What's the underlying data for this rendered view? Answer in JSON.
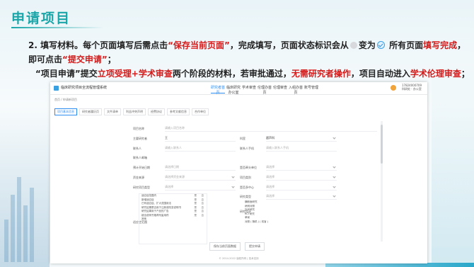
{
  "slide": {
    "title": "申请项目",
    "line1": {
      "p1": "2. 填写材料。每个页面填写后需点击",
      "r1": "“保存当前页面”",
      "p2": "，完成填写，页面状态标识会从",
      "p3": "变为",
      "p4": "所有页面",
      "r2": "填写完成",
      "p5": "，"
    },
    "line2": {
      "p1": "即可点击",
      "r1": "“提交申请”",
      "p2": "；"
    },
    "line3": {
      "p1": "“项目申请”提交",
      "r1": "立项受理+学术审查",
      "p2": "两个阶段的材料，若审批通过，",
      "r2": "无需研究者操作",
      "p3": "，项目自动进入",
      "r3": "学术伦理审查",
      "p4": "；"
    }
  },
  "app": {
    "name": "临床研究项目全流程管理系统",
    "nav": [
      "研究者首页",
      "临床研究办公室",
      "学术审查",
      "伦理办首页",
      "伦理审查",
      "入组办首页",
      "账号管理"
    ],
    "user_line1": "17824000709",
    "user_line2": "科研处 · 办公室",
    "breadcrumb": "首页 / 申请新项目",
    "steps": [
      "项目基本信息",
      "研究者履历页",
      "文件清单",
      "利益冲突声明",
      "经费协议",
      "参考文献信息",
      "合作单位"
    ],
    "form": {
      "project_name_label": "项目名称",
      "project_name_placeholder": "请输入项目名称",
      "funding_label": "主要研究者",
      "funding_value": "王",
      "dept_label": "科室",
      "dept_value": "超声科",
      "contact_label": "联系人",
      "contact_placeholder": "请输入联系人",
      "contact_phone_label": "联系人手机",
      "contact_phone_placeholder": "请输入联系人手机",
      "email_label": "联系人邮箱",
      "email_placeholder": "请输入联系人邮箱",
      "plan_date_label": "预计开始日期",
      "plan_date_placeholder": "请选择日期",
      "lead_unit_label": "是否牵头单位",
      "lead_unit_placeholder": "请选择",
      "fund_source_label": "资金来源",
      "fund_source_placeholder": "请选择资金来源",
      "project_type_label": "项目类别",
      "project_type_placeholder": "请选择",
      "research_type_label": "研究项目类型",
      "research_type_placeholder": "请选择",
      "multi_center_label": "是否多中心",
      "multi_center_placeholder": "请选择",
      "scope_label": "适应症范围",
      "design_label": "研究设计",
      "research_category_label": "研究类型",
      "research_category_placeholder": "请选择"
    },
    "scope_items": [
      {
        "text": "适应症范围内",
        "yes": "是",
        "no": "否"
      },
      {
        "text": "新增适应症",
        "yes": "是",
        "no": "否"
      },
      {
        "text": "已有适应症、扩大范围用法",
        "yes": "是",
        "no": "否"
      },
      {
        "text": "研究结果是否用于注册或改变说明书",
        "yes": "是",
        "no": "否"
      },
      {
        "text": "研究结果用于产品的广告",
        "yes": "是",
        "no": "否"
      },
      {
        "text": "超出说明书推荐剂量用药",
        "yes": "是",
        "no": "否"
      },
      {
        "text": "其他",
        "yes": "",
        "no": ""
      }
    ],
    "design_items": [
      "横断面研究",
      "病例对照",
      "队列研究",
      "RCT研究",
      "单臂",
      "对照 ( 随机 ) ( 双盲 )"
    ],
    "buttons": {
      "save": "保存当前页面数据",
      "submit": "提交申请"
    },
    "footer": "© 2014-2022 版权所有 | 技术支持"
  },
  "colors": {
    "title": "#1aa6a8",
    "highlight_red": "#d51a1a",
    "accent_blue": "#2d8cf0"
  }
}
